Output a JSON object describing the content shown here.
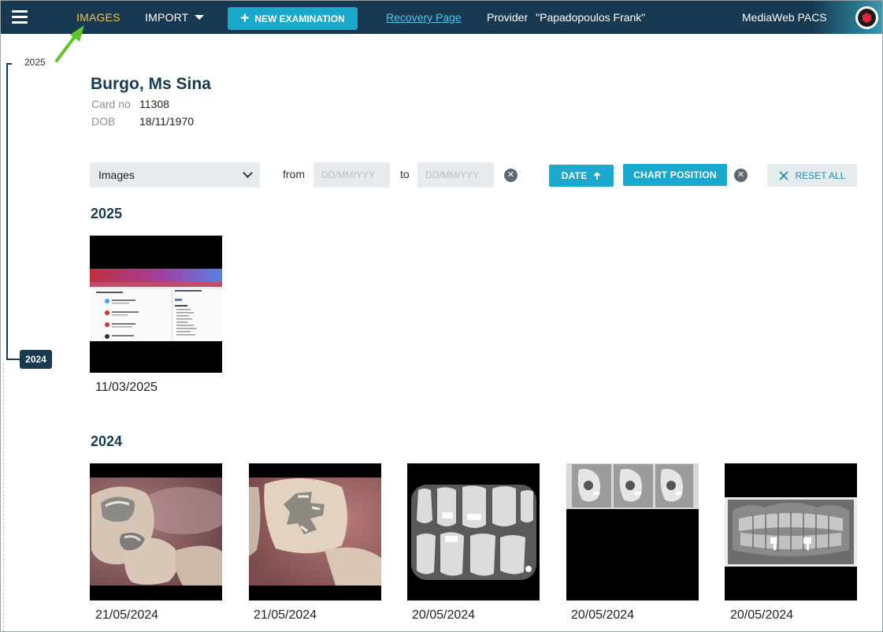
{
  "topbar": {
    "images_label": "IMAGES",
    "import_label": "IMPORT",
    "new_exam_label": "NEW EXAMINATION",
    "recovery_label": "Recovery Page",
    "provider_label": "Provider",
    "provider_name": "\"Papadopoulos Frank\"",
    "app_name": "MediaWeb PACS"
  },
  "timeline": {
    "years": [
      "2025",
      "2024"
    ]
  },
  "patient": {
    "name": "Burgo, Ms Sina",
    "card_label": "Card no",
    "card_value": "11308",
    "dob_label": "DOB",
    "dob_value": "18/11/1970"
  },
  "filters": {
    "type_value": "Images",
    "from_label": "from",
    "to_label": "to",
    "date_placeholder": "DD/MM/YYY",
    "sort_date_label": "DATE",
    "chart_position_label": "CHART POSITION",
    "reset_label": "RESET ALL"
  },
  "groups": [
    {
      "year": "2025",
      "items": [
        {
          "date": "11/03/2025",
          "kind": "screenshot"
        }
      ]
    },
    {
      "year": "2024",
      "items": [
        {
          "date": "21/05/2024",
          "kind": "intraoral-photo"
        },
        {
          "date": "21/05/2024",
          "kind": "intraoral-photo"
        },
        {
          "date": "20/05/2024",
          "kind": "bitewing-xray"
        },
        {
          "date": "20/05/2024",
          "kind": "cephalometric-xrays"
        },
        {
          "date": "20/05/2024",
          "kind": "panoramic-xray"
        }
      ]
    }
  ],
  "colors": {
    "navy": "#173a52",
    "accent": "#1aa8cc",
    "active_nav": "#f2c14e",
    "link": "#4fc3e8",
    "annotation_arrow": "#5cc62a"
  },
  "icons": [
    "menu-icon",
    "caret-down-icon",
    "plus-icon",
    "logo-icon",
    "chevron-down-icon",
    "clear-icon",
    "arrow-up-icon",
    "close-icon"
  ]
}
